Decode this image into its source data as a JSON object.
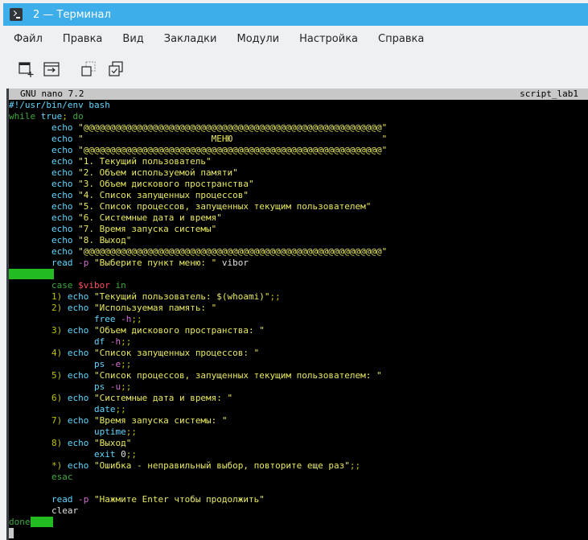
{
  "window": {
    "title": "2 — Терминал",
    "icon": "terminal-icon"
  },
  "menu": [
    "Файл",
    "Правка",
    "Вид",
    "Закладки",
    "Модули",
    "Настройка",
    "Справка"
  ],
  "toolbar": {
    "icons": [
      "new-tab-icon",
      "split-view-icon",
      "copy-icon",
      "paste-icon"
    ]
  },
  "nano": {
    "version": "GNU nano 7.2",
    "filename": "script_lab1"
  },
  "code_lines": [
    "#!/usr/bin/env bash",
    "while true; do",
    "        echo \"@@@@@@@@@@@@@@@@@@@@@@@@@@@@@@@@@@@@@@@@@@@@@@@@@@@@@@@@\"",
    "        echo \"                        МЕНЮ                            \"",
    "        echo \"@@@@@@@@@@@@@@@@@@@@@@@@@@@@@@@@@@@@@@@@@@@@@@@@@@@@@@@@\"",
    "        echo \"1. Текущий пользователь\"",
    "        echo \"2. Объем используемой памяти\"",
    "        echo \"3. Объем дискового пространства\"",
    "        echo \"4. Список запущенных процессов\"",
    "        echo \"5. Список процессов, запущенных текущим пользователем\"",
    "        echo \"6. Системные дата и время\"",
    "        echo \"7. Время запуска системы\"",
    "        echo \"8. Выход\"",
    "        echo \"@@@@@@@@@@@@@@@@@@@@@@@@@@@@@@@@@@@@@@@@@@@@@@@@@@@@@@@@\"",
    "        read -p \"Выберите пункт меню: \" vibor",
    "",
    "        case $vibor in",
    "        1) echo \"Текущий пользователь: $(whoami)\";;",
    "        2) echo \"Используемая память: \"",
    "                free -h;;",
    "        3) echo \"Объем дискового пространства: \"",
    "                df -h;;",
    "        4) echo \"Список запущенных процессов: \"",
    "                ps -e;;",
    "        5) echo \"Список процессов, запущенных текущим пользователем: \"",
    "                ps -u;;",
    "        6) echo \"Системные дата и время: \"",
    "                date;;",
    "        7) echo \"Время запуска системы: \"",
    "                uptime;;",
    "        8) echo \"Выход\"",
    "                exit 0;;",
    "        *) echo \"Ошибка - неправильный выбор, повторите еще раз\";;",
    "        esac",
    "",
    "        read -p \"Нажмите Enter чтобы продолжить\"",
    "        clear",
    "done",
    ""
  ],
  "colors": {
    "keyword": "#3ea83e",
    "command": "#5fd7ff",
    "string": "#e8e860",
    "variable": "#ff5060",
    "whitespace_highlight": "#22bb22"
  }
}
